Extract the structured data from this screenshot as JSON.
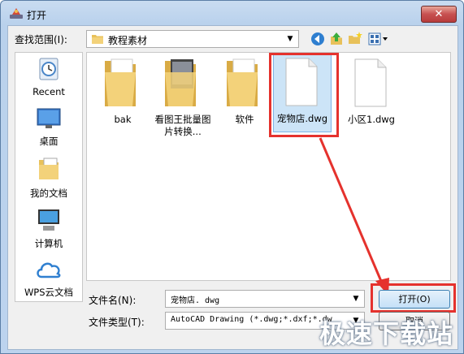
{
  "title": "打开",
  "close_glyph": "✕",
  "look_in": {
    "label": "查找范围(I):",
    "value": "教程素材"
  },
  "places": [
    {
      "label": "Recent",
      "icon": "recent-places-icon"
    },
    {
      "label": "桌面",
      "icon": "desktop-icon"
    },
    {
      "label": "我的文档",
      "icon": "my-documents-icon"
    },
    {
      "label": "计算机",
      "icon": "computer-icon"
    },
    {
      "label": "WPS云文档",
      "icon": "wps-cloud-icon"
    }
  ],
  "files": [
    {
      "name": "bak",
      "type": "folder"
    },
    {
      "name": "看图王批量图片转换...",
      "type": "folder"
    },
    {
      "name": "软件",
      "type": "folder"
    },
    {
      "name": "宠物店.dwg",
      "type": "file",
      "selected": true
    },
    {
      "name": "小区1.dwg",
      "type": "file"
    }
  ],
  "filename": {
    "label": "文件名(N):",
    "value": "宠物店. dwg"
  },
  "filetype": {
    "label": "文件类型(T):",
    "value": "AutoCAD Drawing (*.dwg;*.dxf;*.dw"
  },
  "buttons": {
    "open": "打开(O)",
    "cancel": "取消"
  },
  "watermark": "极速下载站",
  "accent": {
    "highlight_red": "#e5322d",
    "selection": "#cce4f7"
  }
}
